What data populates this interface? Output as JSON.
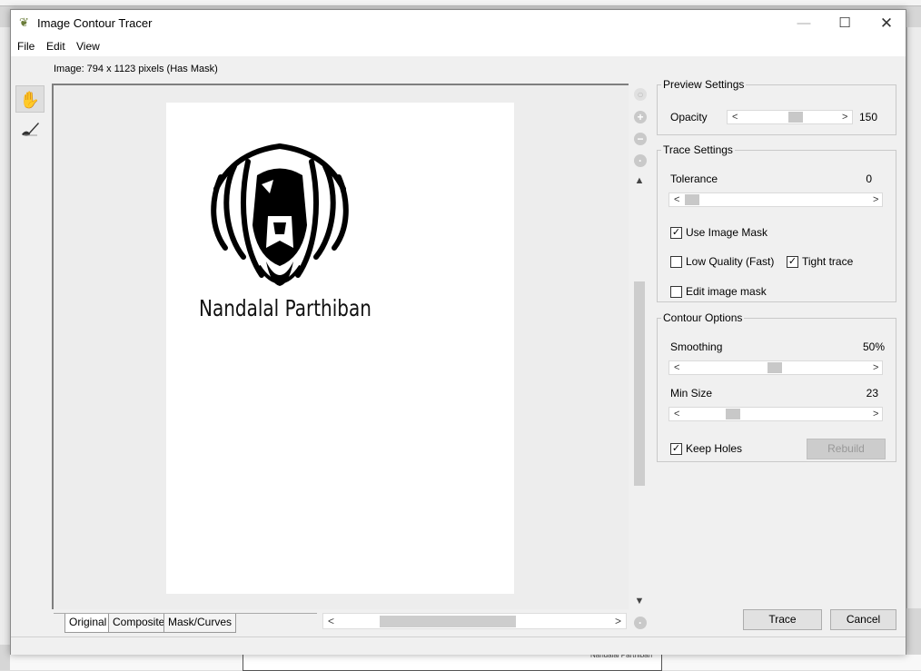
{
  "window": {
    "title": "Image Contour Tracer",
    "minimize": "—",
    "maximize": "☐",
    "close": "✕"
  },
  "menu": [
    "File",
    "Edit",
    "View"
  ],
  "image_info": "Image: 794 x 1123 pixels (Has Mask)",
  "canvas": {
    "caption": "Nandalal Parthiban"
  },
  "tabs": [
    "Original",
    "Composite",
    "Mask/Curves"
  ],
  "preview": {
    "legend": "Preview Settings",
    "opacity_label": "Opacity",
    "opacity_value": "150"
  },
  "trace": {
    "legend": "Trace Settings",
    "tolerance_label": "Tolerance",
    "tolerance_value": "0",
    "use_mask": "Use Image Mask",
    "low_quality": "Low Quality (Fast)",
    "tight_trace": "Tight trace",
    "edit_mask": "Edit image mask"
  },
  "contour": {
    "legend": "Contour Options",
    "smoothing_label": "Smoothing",
    "smoothing_value": "50%",
    "minsize_label": "Min Size",
    "minsize_value": "23",
    "keep_holes": "Keep Holes",
    "rebuild": "Rebuild"
  },
  "buttons": {
    "trace": "Trace",
    "cancel": "Cancel"
  },
  "background": {
    "page_caption": "Nandalal Parthiban"
  }
}
